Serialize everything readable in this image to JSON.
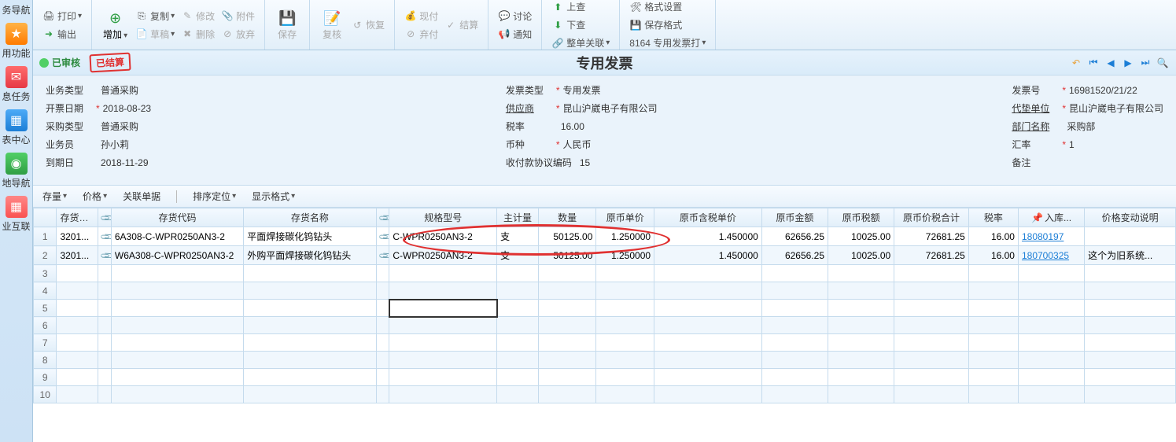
{
  "sidebar": {
    "items": [
      {
        "label": "务导航"
      },
      {
        "label": "用功能"
      },
      {
        "label": "息任务"
      },
      {
        "label": "表中心"
      },
      {
        "label": "地导航"
      },
      {
        "label": "业互联"
      }
    ]
  },
  "ribbon": {
    "print": "打印",
    "export": "输出",
    "add": "增加",
    "copy": "复制",
    "draft": "草稿",
    "modify": "修改",
    "delete": "删除",
    "attach": "附件",
    "abandon": "放弃",
    "save": "保存",
    "recheck": "复核",
    "restore": "恢复",
    "cash": "现付",
    "settle": "结算",
    "discard": "弃付",
    "discuss": "讨论",
    "notify": "通知",
    "upcheck": "上查",
    "downcheck": "下查",
    "assoc": "整单关联",
    "format": "格式设置",
    "saveformat": "保存格式",
    "printtpl": "8164 专用发票打"
  },
  "status": {
    "approved": "已审核",
    "stamp": "已结算"
  },
  "title": "专用发票",
  "form": {
    "col1": [
      {
        "label": "业务类型",
        "value": "普通采购",
        "req": false
      },
      {
        "label": "开票日期",
        "value": "2018-08-23",
        "req": true
      },
      {
        "label": "采购类型",
        "value": "普通采购",
        "req": false
      },
      {
        "label": "业务员",
        "value": "孙小莉",
        "req": false
      },
      {
        "label": "到期日",
        "value": "2018-11-29",
        "req": false
      }
    ],
    "col2": [
      {
        "label": "发票类型",
        "value": "专用发票",
        "req": true
      },
      {
        "label": "供应商",
        "value": "昆山沪崴电子有限公司",
        "req": true,
        "underline": true
      },
      {
        "label": "税率",
        "value": "16.00",
        "req": false
      },
      {
        "label": "币种",
        "value": "人民币",
        "req": true
      },
      {
        "label": "收付款协议编码",
        "value": "15",
        "req": false
      }
    ],
    "col3": [
      {
        "label": "发票号",
        "value": "16981520/21/22",
        "req": true
      },
      {
        "label": "代垫单位",
        "value": "昆山沪崴电子有限公司",
        "req": true,
        "underline": true
      },
      {
        "label": "部门名称",
        "value": "采购部",
        "req": false,
        "underline": true
      },
      {
        "label": "汇率",
        "value": "1",
        "req": true
      },
      {
        "label": "备注",
        "value": "",
        "req": false
      }
    ]
  },
  "toolbar2": {
    "inventory": "存量",
    "price": "价格",
    "assocdoc": "关联单据",
    "sortpos": "排序定位",
    "dispfmt": "显示格式"
  },
  "grid": {
    "headers": {
      "invcode": "存货编码",
      "invalias": "存货代码",
      "invname": "存货名称",
      "spec": "规格型号",
      "unit": "主计量",
      "qty": "数量",
      "uprice": "原币单价",
      "taxuprice": "原币含税单价",
      "amount": "原币金额",
      "taxamt": "原币税额",
      "total": "原币价税合计",
      "taxrate": "税率",
      "instock": "入库",
      "pricechange": "价格变动说明"
    },
    "rows": [
      {
        "invcode": "3201...",
        "invalias": "6A308-C-WPR0250AN3-2",
        "invname": "平面焊接碳化钨钻头",
        "spec": "C-WPR0250AN3-2",
        "unit": "支",
        "qty": "50125.00",
        "uprice": "1.250000",
        "taxuprice": "1.450000",
        "amount": "62656.25",
        "taxamt": "10025.00",
        "total": "72681.25",
        "taxrate": "16.00",
        "instock": "18080197",
        "pricechange": ""
      },
      {
        "invcode": "3201...",
        "invalias": "W6A308-C-WPR0250AN3-2",
        "invname": "外购平面焊接碳化钨钻头",
        "spec": "C-WPR0250AN3-2",
        "unit": "支",
        "qty": "50125.00",
        "uprice": "1.250000",
        "taxuprice": "1.450000",
        "amount": "62656.25",
        "taxamt": "10025.00",
        "total": "72681.25",
        "taxrate": "16.00",
        "instock": "180700325",
        "pricechange": "这个为旧系统..."
      }
    ]
  }
}
